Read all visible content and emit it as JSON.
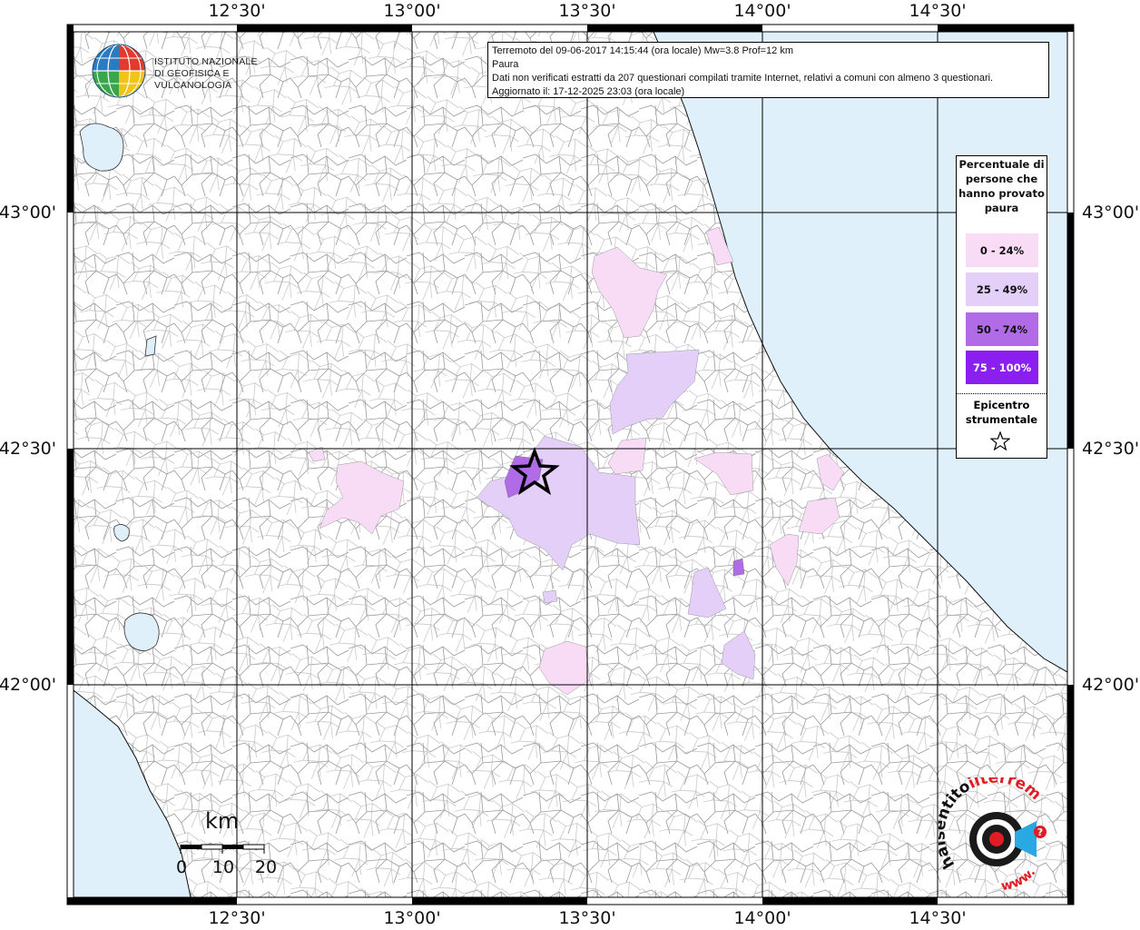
{
  "map": {
    "longitude_ticks": [
      "12°30'",
      "13°00'",
      "13°30'",
      "14°00'",
      "14°30'"
    ],
    "latitude_ticks": [
      "43°00'",
      "42°30'",
      "42°00'"
    ],
    "sea_color": "#dff0fb",
    "land_color": "#ffffff",
    "border_color": "#8a8a8a"
  },
  "info_box": {
    "line1": "Terremoto del 09-06-2017 14:15:44 (ora locale) Mw=3.8 Prof=12 km",
    "line2": "Paura",
    "line3": "Dati non verificati estratti da 207 questionari compilati tramite Internet, relativi a comuni con almeno 3 questionari.",
    "line4": "Aggiornato il: 17-12-2025 23:03 (ora locale)"
  },
  "logo": {
    "line1": "ISTITUTO NAZIONALE",
    "line2": "DI GEOFISICA E VULCANOLOGIA"
  },
  "legend": {
    "title": "Percentuale di persone che hanno provato paura",
    "items": [
      {
        "label": "0 - 24%",
        "color": "#f8dcf6",
        "text_color": "#111111"
      },
      {
        "label": "25 - 49%",
        "color": "#e3cff8",
        "text_color": "#111111"
      },
      {
        "label": "50 - 74%",
        "color": "#b26be6",
        "text_color": "#111111"
      },
      {
        "label": "75 - 100%",
        "color": "#8a1ff0",
        "text_color": "#ffffff"
      }
    ],
    "epicenter_label": "Epicentro strumentale",
    "epicenter_icon": "star-icon"
  },
  "scalebar": {
    "unit": "km",
    "labels": [
      "0",
      "10",
      "20"
    ]
  },
  "hsente_logo": {
    "text_top": "haisentito",
    "text_brand": "ilterremoto.it",
    "text_bottom": "www.",
    "question_mark": "?"
  }
}
